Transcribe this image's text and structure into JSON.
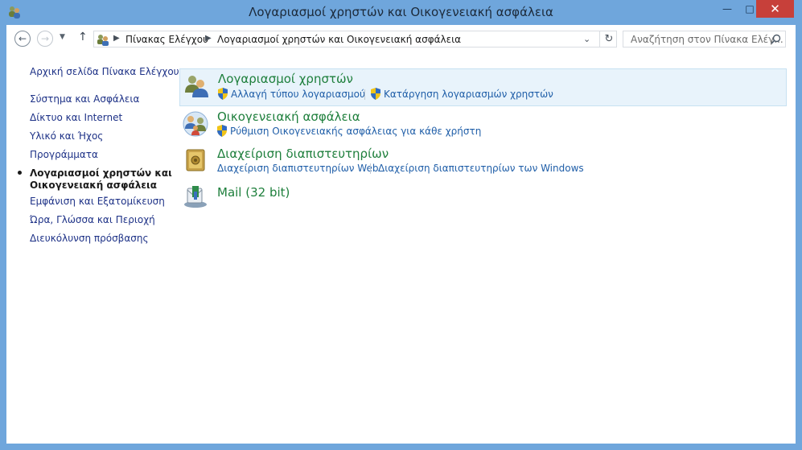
{
  "window": {
    "title": "Λογαριασμοί χρηστών και Οικογενειακή ασφάλεια",
    "controls": {
      "minimize": "—",
      "maximize": "□",
      "close": "✕"
    }
  },
  "address": {
    "breadcrumb": [
      "Πίνακας Ελέγχου",
      "Λογαριασμοί χρηστών και Οικογενειακή ασφάλεια"
    ],
    "separator": "▶",
    "dropdown": "⌄",
    "refresh": "↻"
  },
  "nav": {
    "back": "←",
    "forward": "→",
    "recent": "▼",
    "up": "↑"
  },
  "search": {
    "placeholder": "Αναζήτηση στον Πίνακα Ελέγ..."
  },
  "sidebar": {
    "home": "Αρχική σελίδα Πίνακα Ελέγχου",
    "items": [
      {
        "label": "Σύστημα και Ασφάλεια"
      },
      {
        "label": "Δίκτυο και Internet"
      },
      {
        "label": "Υλικό και Ήχος"
      },
      {
        "label": "Προγράμματα"
      },
      {
        "label_line1": "Λογαριασμοί χρηστών και",
        "label_line2": "Οικογενειακή ασφάλεια",
        "active": true
      },
      {
        "label": "Εμφάνιση και Εξατομίκευση"
      },
      {
        "label": "Ώρα, Γλώσσα και Περιοχή"
      },
      {
        "label": "Διευκόλυνση πρόσβασης"
      }
    ]
  },
  "categories": [
    {
      "title": "Λογαριασμοί χρηστών",
      "icon": "users-icon",
      "links": [
        "Αλλαγή τύπου λογαριασμού",
        "Κατάργηση λογαριασμών χρηστών"
      ]
    },
    {
      "title": "Οικογενειακή ασφάλεια",
      "icon": "family-safety-icon",
      "links": [
        "Ρύθμιση Οικογενειακής ασφάλειας για κάθε χρήστη"
      ]
    },
    {
      "title": "Διαχείριση διαπιστευτηρίων",
      "icon": "credential-vault-icon",
      "links": [
        "Διαχείριση διαπιστευτηρίων Web",
        "Διαχείριση διαπιστευτηρίων των Windows"
      ]
    },
    {
      "title": "Mail (32 bit)",
      "icon": "mail-icon",
      "links": []
    }
  ],
  "colors": {
    "frame": "#6fa6dc",
    "close_button": "#c7403a",
    "category_title": "#1e7f3c",
    "link": "#1f5ea8",
    "highlight": "#e8f3fb"
  }
}
